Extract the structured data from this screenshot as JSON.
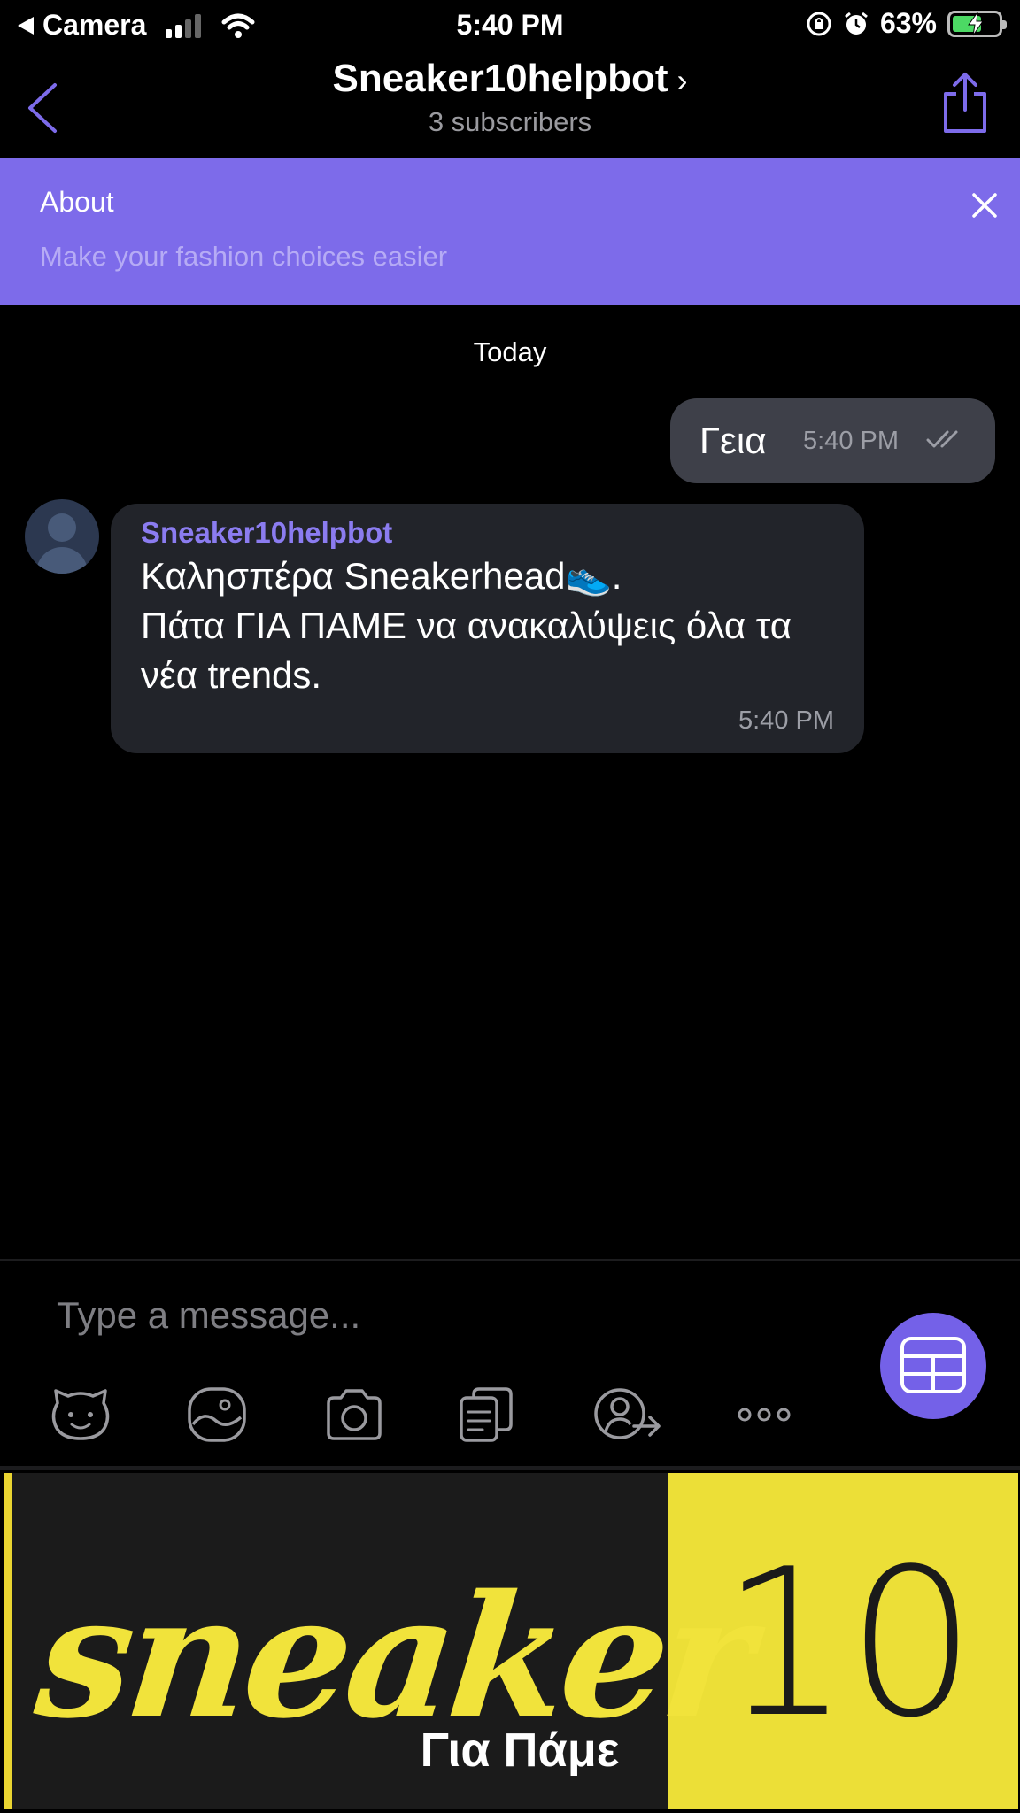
{
  "status_bar": {
    "back_app": "Camera",
    "time": "5:40 PM",
    "battery": "63%",
    "battery_level": 0.63,
    "icons": [
      "back-triangle-icon",
      "signal-icon",
      "wifi-icon",
      "orientation-lock-icon",
      "alarm-icon",
      "battery-charging-icon"
    ]
  },
  "header": {
    "title": "Sneaker10helpbot",
    "chevron": "›",
    "subtitle": "3 subscribers",
    "icons": [
      "back-chevron-icon",
      "share-icon"
    ]
  },
  "about": {
    "label": "About",
    "description": "Make your fashion choices easier"
  },
  "chat": {
    "date_separator": "Today",
    "messages": [
      {
        "direction": "outgoing",
        "text": "Γεια",
        "time": "5:40 PM",
        "status": "read"
      },
      {
        "direction": "incoming",
        "sender": "Sneaker10helpbot",
        "text": "Καλησπέρα Sneakerhead👟.\nΠάτα ΓΙΑ ΠΑΜΕ να ανακαλύψεις όλα τα νέα trends.",
        "time": "5:40 PM"
      }
    ]
  },
  "composer": {
    "placeholder": "Type a message...",
    "tools": [
      "sticker-icon",
      "gallery-icon",
      "camera-icon",
      "files-icon",
      "contact-share-icon",
      "more-icon"
    ]
  },
  "bot_keyboard": {
    "brand_word": "sneaker",
    "brand_number": "10",
    "button_label": "Για Πάμε"
  },
  "colors": {
    "accent": "#7d6bea",
    "bubble_in": "#22242a",
    "bubble_out": "#3e4049",
    "brand_yellow": "#ecdf37"
  }
}
